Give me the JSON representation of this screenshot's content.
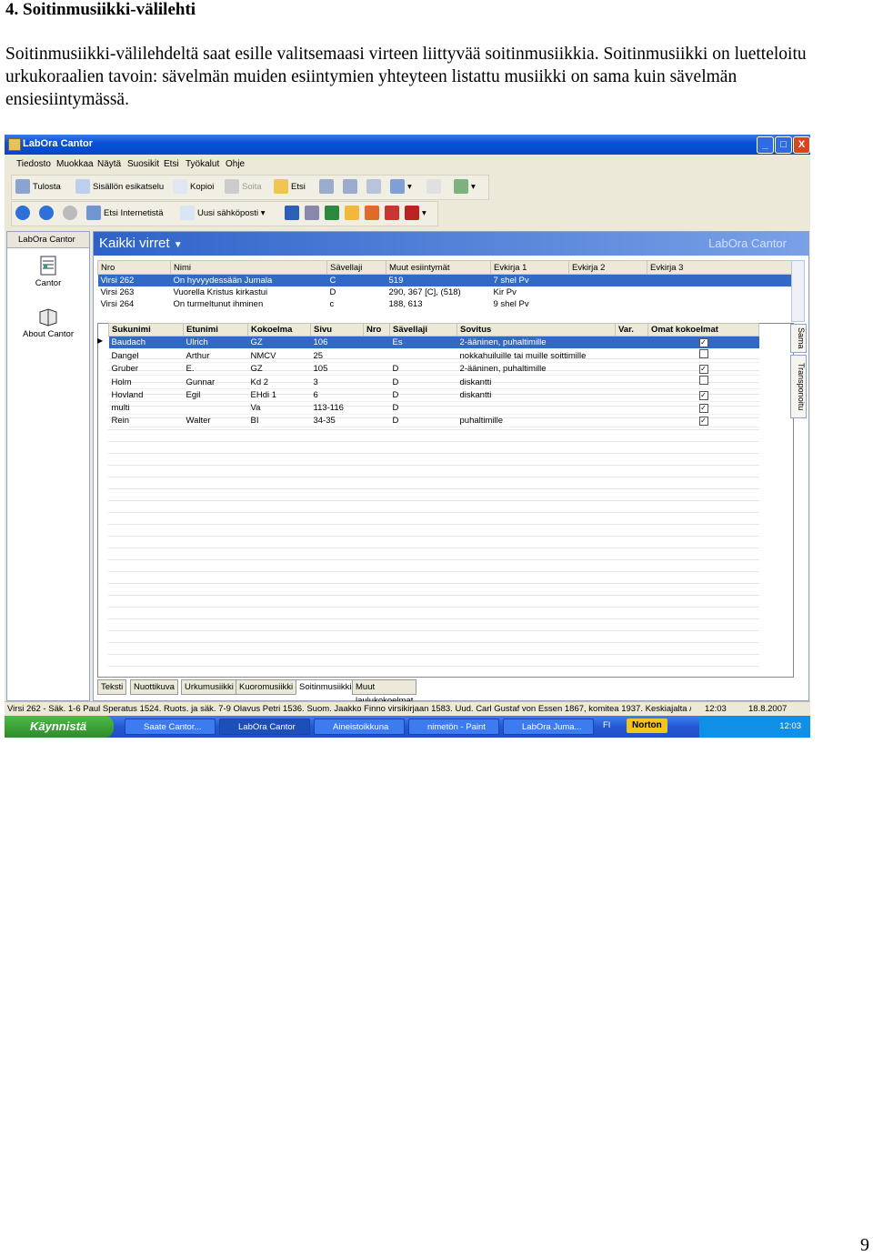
{
  "doc": {
    "heading": "4. Soitinmusiikki-välilehti",
    "paragraph": "Soitinmusiikki-välilehdeltä saat esille valitsemaasi virteen liittyvää soitinmusiikkia. Soitinmusiikki on luetteloitu urkukoraalien tavoin: sävelmän muiden esiintymien yhteyteen listattu musiikki on sama kuin sävelmän ensiesiintymässä.",
    "page_number": "9"
  },
  "window": {
    "title": "LabOra Cantor",
    "controls": {
      "minimize": "_",
      "maximize": "□",
      "close": "X"
    }
  },
  "menu": [
    "Tiedosto",
    "Muokkaa",
    "Näytä",
    "Suosikit",
    "Etsi",
    "Työkalut",
    "Ohje"
  ],
  "toolbar1": {
    "print": "Tulosta",
    "preview": "Sisällön esikatselu",
    "copy": "Kopioi",
    "play": "Soita",
    "search": "Etsi"
  },
  "toolbar2": {
    "internet_search": "Etsi Internetistä",
    "new_email": "Uusi sähköposti"
  },
  "sidebar": {
    "header": "LabOra Cantor",
    "items": [
      {
        "label": "Cantor",
        "icon": "music-sheet-icon"
      },
      {
        "label": "About Cantor",
        "icon": "book-icon"
      }
    ]
  },
  "panel": {
    "title": "Kaikki virret",
    "brand": "LabOra Cantor"
  },
  "hymn_table": {
    "columns": [
      "Nro",
      "Nimi",
      "Sävellaji",
      "Muut esiintymät",
      "Evkirja 1",
      "Evkirja 2",
      "Evkirja 3"
    ],
    "rows": [
      {
        "nro": "Virsi 262",
        "nimi": "On hyvyydessään Jumala",
        "savellaji": "C",
        "muut": "519",
        "ev1": "7 shel Pv",
        "ev2": "",
        "ev3": "",
        "selected": true
      },
      {
        "nro": "Virsi 263",
        "nimi": "Vuorella Kristus kirkastui",
        "savellaji": "D",
        "muut": "290, 367 [C], (518)",
        "ev1": "Kir Pv",
        "ev2": "",
        "ev3": "",
        "selected": false
      },
      {
        "nro": "Virsi 264",
        "nimi": "On turmeltunut ihminen",
        "savellaji": "c",
        "muut": "188, 613",
        "ev1": "9 shel Pv",
        "ev2": "",
        "ev3": "",
        "selected": false
      }
    ]
  },
  "instrumental_table": {
    "columns": [
      "Sukunimi",
      "Etunimi",
      "Kokoelma",
      "Sivu",
      "Nro",
      "Sävellaji",
      "Sovitus",
      "Var.",
      "Omat kokoelmat"
    ],
    "rows": [
      {
        "sukunimi": "Baudach",
        "etunimi": "Ulrich",
        "kokoelma": "GZ",
        "sivu": "106",
        "nro": "",
        "savellaji": "Es",
        "sovitus": "2-ääninen, puhaltimille",
        "var": "",
        "omat": true,
        "selected": true
      },
      {
        "sukunimi": "Dangel",
        "etunimi": "Arthur",
        "kokoelma": "NMCV",
        "sivu": "25",
        "nro": "",
        "savellaji": "",
        "sovitus": "nokkahuiluille tai muille soittimille",
        "var": "",
        "omat": false,
        "selected": false
      },
      {
        "sukunimi": "Gruber",
        "etunimi": "E.",
        "kokoelma": "GZ",
        "sivu": "105",
        "nro": "",
        "savellaji": "D",
        "sovitus": "2-ääninen, puhaltimille",
        "var": "",
        "omat": true,
        "selected": false
      },
      {
        "sukunimi": "Holm",
        "etunimi": "Gunnar",
        "kokoelma": "Kd 2",
        "sivu": "3",
        "nro": "",
        "savellaji": "D",
        "sovitus": "diskantti",
        "var": "",
        "omat": false,
        "selected": false
      },
      {
        "sukunimi": "Hovland",
        "etunimi": "Egil",
        "kokoelma": "EHdi 1",
        "sivu": "6",
        "nro": "",
        "savellaji": "D",
        "sovitus": "diskantti",
        "var": "",
        "omat": true,
        "selected": false
      },
      {
        "sukunimi": "multi",
        "etunimi": "",
        "kokoelma": "Va",
        "sivu": "113-116",
        "nro": "",
        "savellaji": "D",
        "sovitus": "",
        "var": "",
        "omat": true,
        "selected": false
      },
      {
        "sukunimi": "Rein",
        "etunimi": "Walter",
        "kokoelma": "BI",
        "sivu": "34-35",
        "nro": "",
        "savellaji": "D",
        "sovitus": "puhaltimille",
        "var": "",
        "omat": true,
        "selected": false
      }
    ]
  },
  "tabs": [
    "Teksti",
    "Nuottikuva",
    "Urkumusiikki",
    "Kuoromusiikki",
    "Soitinmusiikki",
    "Muut laulukokoelmat"
  ],
  "active_tab": "Soitinmusiikki",
  "vertical_tabs": [
    "Sama",
    "Transponoitu"
  ],
  "status": {
    "text": "Virsi 262 - Säk. 1-6 Paul Speratus 1524. Ruots. ja säk. 7-9 Olavus Petri 1536. Suom. Jaakko Finno virsikirjaan 1583. Uud. Carl Gustaf von Essen 1867, komitea 1937. Keskiajalta / Saks",
    "time": "12:03",
    "date": "18.8.2007"
  },
  "taskbar": {
    "start": "Käynnistä",
    "tasks": [
      "Saate Cantor...",
      "LabOra Cantor",
      "Aineistoikkuna",
      "nimetön - Paint",
      "LabOra Juma..."
    ],
    "active_task": "LabOra Cantor",
    "language": "FI",
    "norton": "Norton",
    "clock": "12:03"
  },
  "colors": {
    "selection": "#316ac5",
    "titlebar": "#0a52d6",
    "start_button": "#2e8b2a"
  }
}
